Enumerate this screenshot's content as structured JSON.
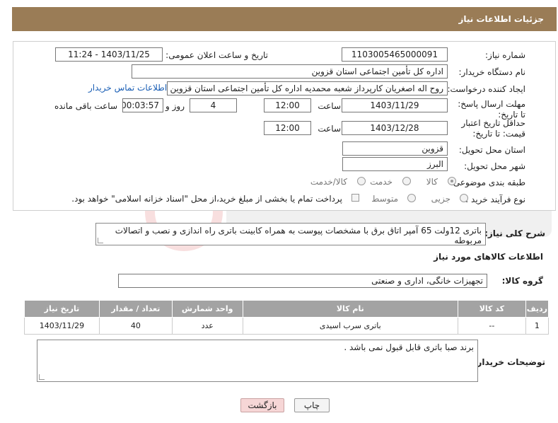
{
  "header": {
    "title": "جزئیات اطلاعات نیاز"
  },
  "form": {
    "need_number_label": "شماره نیاز:",
    "need_number": "1103005465000091",
    "announce_label": "تاریخ و ساعت اعلان عمومی:",
    "announce_value": "1403/11/25 - 11:24",
    "buyer_org_label": "نام دستگاه خریدار:",
    "buyer_org": "اداره کل تأمین اجتماعی استان قزوین",
    "requester_label": "ایجاد کننده درخواست:",
    "requester": "روح اله اصغریان کارپرداز شعبه محمدیه  اداره کل تأمین اجتماعی استان قزوین",
    "contact_link": "اطلاعات تماس خریدار",
    "deadline_label": "مهلت ارسال پاسخ: تا تاریخ:",
    "deadline_date": "1403/11/29",
    "time_label": "ساعت",
    "deadline_time": "12:00",
    "days_value": "4",
    "days_label": "روز و",
    "remaining_time": "00:03:57",
    "remaining_label": "ساعت باقی مانده",
    "validity_label": "حداقل تاریخ اعتبار قیمت: تا تاریخ:",
    "validity_date": "1403/12/28",
    "validity_time": "12:00",
    "province_label": "استان محل تحویل:",
    "province": "قزوین",
    "city_label": "شهر محل تحویل:",
    "city": "البرز",
    "category_label": "طبقه بندی موضوعی:",
    "category_options": [
      "کالا",
      "خدمت",
      "کالا/خدمت"
    ],
    "category_selected": "کالا",
    "process_label": "نوع فرآیند خرید :",
    "process_options": [
      "جزیی",
      "متوسط"
    ],
    "payment_note": "پرداخت تمام یا بخشی از مبلغ خرید،از محل \"اسناد خزانه اسلامی\" خواهد بود."
  },
  "summary": {
    "label": "شرح کلی نیاز:",
    "text": "باتری 12ولت 65 آمپر اتاق برق با مشخصات پیوست به همراه کابینت باتری راه اندازی و نصب و اتصالات مربوطه"
  },
  "goods": {
    "section_title": "اطلاعات کالاهای مورد نیاز",
    "group_label": "گروه کالا:",
    "group_value": "تجهیزات خانگی، اداری و صنعتی",
    "columns": [
      "ردیف",
      "کد کالا",
      "نام کالا",
      "واحد شمارش",
      "تعداد / مقدار",
      "تاریخ نیاز"
    ],
    "rows": [
      {
        "row": "1",
        "code": "--",
        "name": "باتری سرب اسیدی",
        "unit": "عدد",
        "qty": "40",
        "date": "1403/11/29"
      }
    ]
  },
  "buyer_notes": {
    "label": "توضیحات خریدار:",
    "text": "برند صبا باتری قابل قبول نمی باشد ."
  },
  "buttons": {
    "print": "چاپ",
    "back": "بازگشت"
  },
  "colors": {
    "header_bg": "#9a7c56",
    "table_header_bg": "#a3a3a3",
    "link": "#1b5fb5",
    "back_btn_bg": "#f6d6d6"
  }
}
